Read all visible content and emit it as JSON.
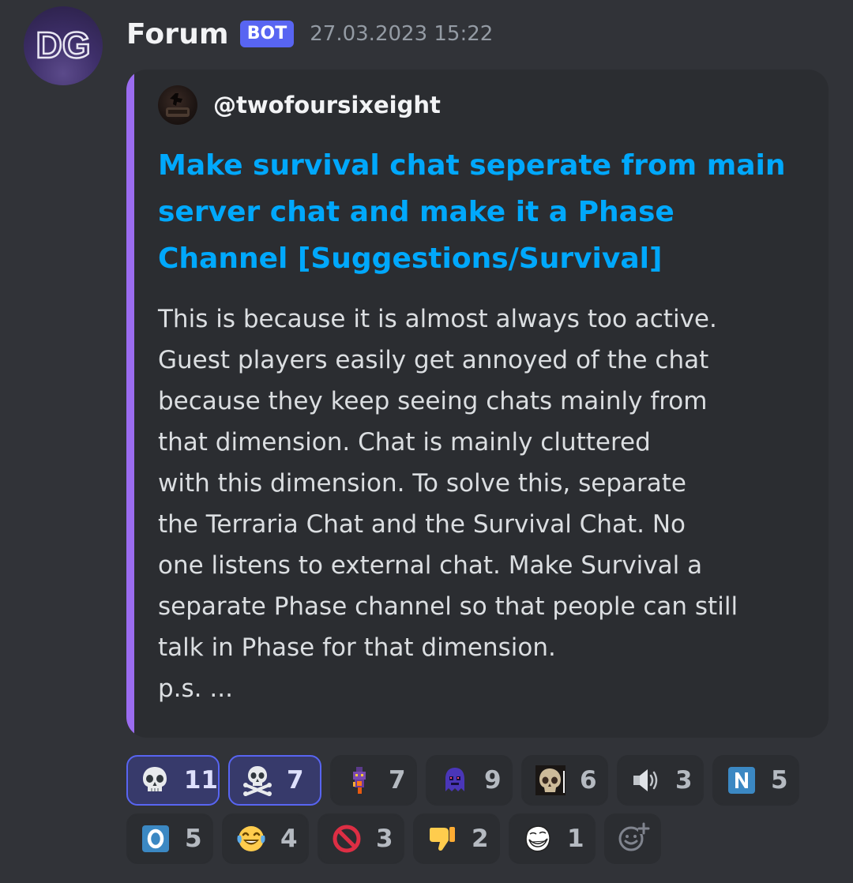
{
  "message": {
    "avatar_text": "DG",
    "author": "Forum",
    "bot_tag": "BOT",
    "timestamp": "27.03.2023 15:22"
  },
  "embed": {
    "accent_color": "#9b6cf0",
    "author_name": "@twofoursixeight",
    "title": "Make survival chat seperate from main server chat and make it a Phase Channel [Suggestions/Survival]",
    "description": "This is because it is almost always too active.\nGuest players easily get annoyed of the chat\nbecause they keep seeing chats mainly from\nthat dimension. Chat is mainly cluttered\nwith this dimension. To solve this, separate\nthe Terraria Chat and the Survival Chat. No\none listens to external chat. Make Survival a\nseparate Phase channel so that people can still\ntalk in Phase for that dimension.\np.s. ..."
  },
  "reactions": {
    "row1": [
      {
        "emoji": "skull-icon",
        "count": "11",
        "me": true
      },
      {
        "emoji": "skull-crossbones-icon",
        "count": "7",
        "me": true
      },
      {
        "emoji": "fire-imp-icon",
        "count": "7",
        "me": false
      },
      {
        "emoji": "purple-ghost-icon",
        "count": "9",
        "me": false
      },
      {
        "emoji": "realistic-skull-icon",
        "count": "6",
        "me": false
      },
      {
        "emoji": "speaker-icon",
        "count": "3",
        "me": false
      },
      {
        "emoji": "n-letter-icon",
        "count": "5",
        "me": false
      }
    ],
    "row2": [
      {
        "emoji": "o-letter-icon",
        "count": "5",
        "me": false
      },
      {
        "emoji": "crying-laughing-icon",
        "count": "4",
        "me": false
      },
      {
        "emoji": "prohibited-icon",
        "count": "3",
        "me": false
      },
      {
        "emoji": "thumbs-down-icon",
        "count": "2",
        "me": false
      },
      {
        "emoji": "troll-face-icon",
        "count": "1",
        "me": false
      }
    ],
    "add_reaction_icon": "add-reaction-icon"
  },
  "colors": {
    "background": "#313338",
    "embed_background": "#2b2d31",
    "link": "#00a8fc",
    "bot_tag": "#5865f2"
  }
}
